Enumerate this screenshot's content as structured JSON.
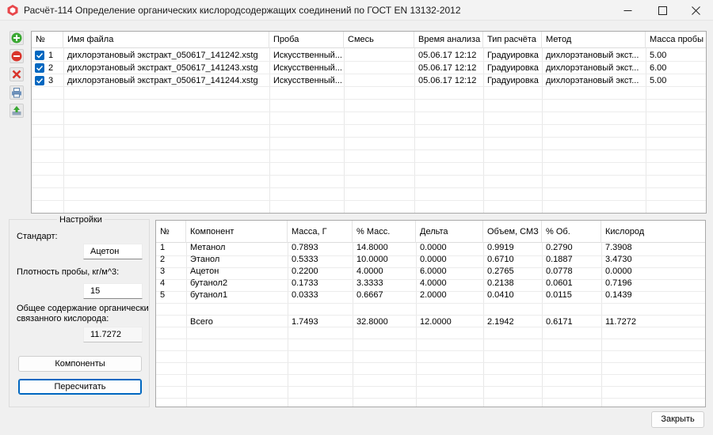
{
  "window": {
    "title": "Расчёт-114 Определение органических кислородсодержащих соединений по ГОСТ EN 13132-2012"
  },
  "toolbar": {
    "icons": [
      "add-icon",
      "remove-icon",
      "delete-icon",
      "print-icon",
      "export-icon"
    ]
  },
  "files": {
    "columns": [
      "№",
      "Имя файла",
      "Проба",
      "Смесь",
      "Время анализа",
      "Тип расчёта",
      "Метод",
      "Масса пробы"
    ],
    "rows": [
      {
        "checked": true,
        "num": "1",
        "file": "дихлорэтановый экстракт_050617_141242.xstg",
        "sample": "Искусственный...",
        "mix": "",
        "time": "05.06.17  12:12",
        "calc_type": "Градуировка",
        "method": "дихлорэтановый экст...",
        "mass": "5.00"
      },
      {
        "checked": true,
        "num": "2",
        "file": "дихлорэтановый экстракт_050617_141243.xstg",
        "sample": "Искусственный...",
        "mix": "",
        "time": "05.06.17  12:12",
        "calc_type": "Градуировка",
        "method": "дихлорэтановый экст...",
        "mass": "6.00"
      },
      {
        "checked": true,
        "num": "3",
        "file": "дихлорэтановый экстракт_050617_141244.xstg",
        "sample": "Искусственный...",
        "mix": "",
        "time": "05.06.17  12:12",
        "calc_type": "Градуировка",
        "method": "дихлорэтановый экст...",
        "mass": "5.00"
      }
    ]
  },
  "settings": {
    "legend": "Настройки",
    "standard_label": "Стандарт:",
    "standard_value": "Ацетон",
    "density_label": "Плотность пробы, кг/м^3:",
    "density_value": "15",
    "oxygen_label_1": "Общее содержание органически",
    "oxygen_label_2": "связанного кислорода:",
    "oxygen_value": "11.7272",
    "components_button": "Компоненты",
    "recalc_button": "Пересчитать"
  },
  "components": {
    "columns": [
      "№",
      "Компонент",
      "Масса, Г",
      "% Масс.",
      "Дельта",
      "Объем, СМЗ",
      "% Об.",
      "Кислород"
    ],
    "rows": [
      [
        "1",
        "Метанол",
        "0.7893",
        "14.8000",
        "0.0000",
        "0.9919",
        "0.2790",
        "7.3908"
      ],
      [
        "2",
        "Этанол",
        "0.5333",
        "10.0000",
        "0.0000",
        "0.6710",
        "0.1887",
        "3.4730"
      ],
      [
        "3",
        "Ацетон",
        "0.2200",
        "4.0000",
        "6.0000",
        "0.2765",
        "0.0778",
        "0.0000"
      ],
      [
        "4",
        "бутанол2",
        "0.1733",
        "3.3333",
        "4.0000",
        "0.2138",
        "0.0601",
        "0.7196"
      ],
      [
        "5",
        "бутанол1",
        "0.0333",
        "0.6667",
        "2.0000",
        "0.0410",
        "0.0115",
        "0.1439"
      ]
    ],
    "total": [
      "",
      "Всего",
      "1.7493",
      "32.8000",
      "12.0000",
      "2.1942",
      "0.6171",
      "11.7272"
    ]
  },
  "footer": {
    "close_button": "Закрыть"
  },
  "colors": {
    "accent": "#0067c0",
    "add": "#3aa832",
    "remove": "#d9342b"
  }
}
